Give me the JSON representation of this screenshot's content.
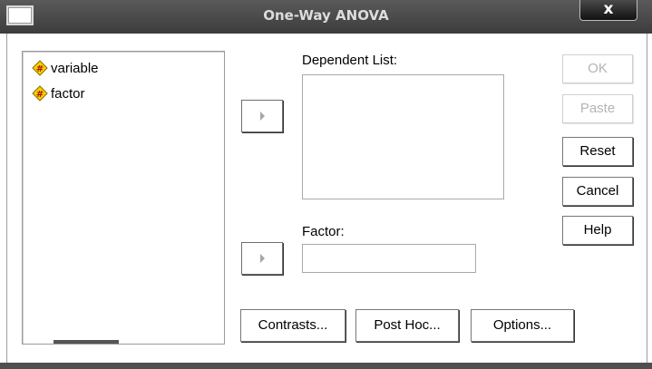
{
  "window": {
    "title": "One-Way ANOVA",
    "close_label": "x"
  },
  "variables": [
    {
      "label": "variable",
      "icon": "scale-variable-icon"
    },
    {
      "label": "factor",
      "icon": "scale-variable-icon"
    }
  ],
  "fields": {
    "dependent_list_label": "Dependent List:",
    "factor_label": "Factor:"
  },
  "buttons": {
    "ok": "OK",
    "paste": "Paste",
    "reset": "Reset",
    "cancel": "Cancel",
    "help": "Help",
    "contrasts": "Contrasts...",
    "post_hoc": "Post Hoc...",
    "options": "Options..."
  },
  "colors": {
    "titlebar": "#3c3c3c",
    "title_text": "#dcdcdc",
    "disabled_text": "#b4b4b4",
    "icon_fill": "#f5d100"
  }
}
